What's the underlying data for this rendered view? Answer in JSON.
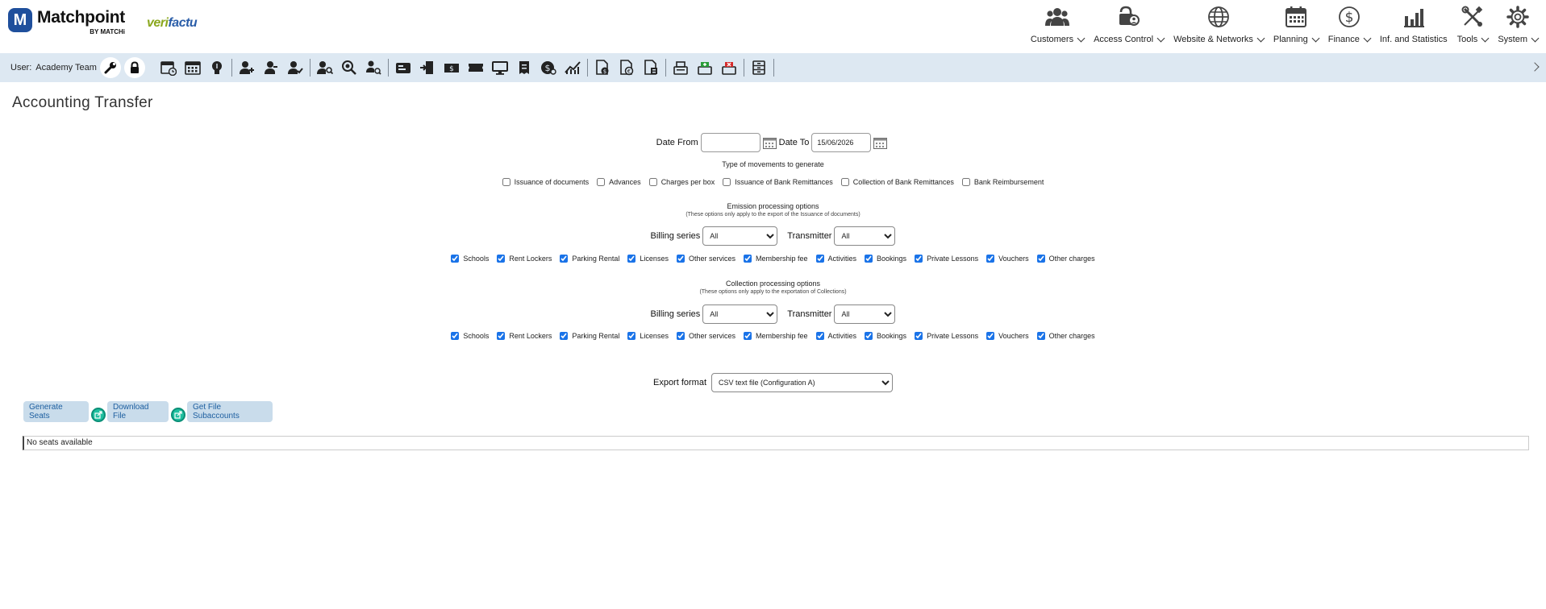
{
  "header": {
    "logo_text": "Matchpoint",
    "logo_letter": "M",
    "logo_sub": "BY MATCHi",
    "partner_logo_a": "veri",
    "partner_logo_b": "factu",
    "nav": [
      {
        "label": "Customers",
        "icon": "customers-icon",
        "dropdown": true
      },
      {
        "label": "Access Control",
        "icon": "access-control-icon",
        "dropdown": true
      },
      {
        "label": "Website & Networks",
        "icon": "globe-icon",
        "dropdown": true
      },
      {
        "label": "Planning",
        "icon": "calendar-icon",
        "dropdown": true
      },
      {
        "label": "Finance",
        "icon": "dollar-icon",
        "dropdown": true
      },
      {
        "label": "Inf. and Statistics",
        "icon": "bar-chart-icon",
        "dropdown": false
      },
      {
        "label": "Tools",
        "icon": "tools-icon",
        "dropdown": true
      },
      {
        "label": "System",
        "icon": "gear-icon",
        "dropdown": true
      }
    ]
  },
  "toolbar": {
    "user_label": "User:",
    "user_name": "Academy Team"
  },
  "page": {
    "title": "Accounting Transfer"
  },
  "dates": {
    "from_label": "Date From",
    "from_value": "",
    "to_label": "Date To",
    "to_value": "15/06/2026"
  },
  "movements": {
    "heading": "Type of movements to generate",
    "options": [
      {
        "label": "Issuance of documents",
        "checked": false
      },
      {
        "label": "Advances",
        "checked": false
      },
      {
        "label": "Charges per box",
        "checked": false
      },
      {
        "label": "Issuance of Bank Remittances",
        "checked": false
      },
      {
        "label": "Collection of Bank Remittances",
        "checked": false
      },
      {
        "label": "Bank Reimbursement",
        "checked": false
      }
    ]
  },
  "emission": {
    "heading": "Emission processing options",
    "note": "(These options only apply to the export of the Issuance of documents)",
    "billing_label": "Billing series",
    "billing_value": "All",
    "transmitter_label": "Transmitter",
    "transmitter_value": "All",
    "options": [
      {
        "label": "Schools",
        "checked": true
      },
      {
        "label": "Rent Lockers",
        "checked": true
      },
      {
        "label": "Parking Rental",
        "checked": true
      },
      {
        "label": "Licenses",
        "checked": true
      },
      {
        "label": "Other services",
        "checked": true
      },
      {
        "label": "Membership fee",
        "checked": true
      },
      {
        "label": "Activities",
        "checked": true
      },
      {
        "label": "Bookings",
        "checked": true
      },
      {
        "label": "Private Lessons",
        "checked": true
      },
      {
        "label": "Vouchers",
        "checked": true
      },
      {
        "label": "Other charges",
        "checked": true
      }
    ]
  },
  "collection": {
    "heading": "Collection processing options",
    "note": "(These options only apply to the exportation of Collections)",
    "billing_label": "Billing series",
    "billing_value": "All",
    "transmitter_label": "Transmitter",
    "transmitter_value": "All",
    "options": [
      {
        "label": "Schools",
        "checked": true
      },
      {
        "label": "Rent Lockers",
        "checked": true
      },
      {
        "label": "Parking Rental",
        "checked": true
      },
      {
        "label": "Licenses",
        "checked": true
      },
      {
        "label": "Other services",
        "checked": true
      },
      {
        "label": "Membership fee",
        "checked": true
      },
      {
        "label": "Activities",
        "checked": true
      },
      {
        "label": "Bookings",
        "checked": true
      },
      {
        "label": "Private Lessons",
        "checked": true
      },
      {
        "label": "Vouchers",
        "checked": true
      },
      {
        "label": "Other charges",
        "checked": true
      }
    ]
  },
  "export": {
    "label": "Export format",
    "value": "CSV text file (Configuration A)"
  },
  "actions": {
    "generate_label": "Generate Seats",
    "download_label": "Download File",
    "subaccounts_label": "Get File Subaccounts"
  },
  "results": {
    "empty_text": "No seats available"
  },
  "colors": {
    "toolbar_bg": "#dde8f2",
    "button_bg": "#c9dceb",
    "button_text": "#1e5fa0",
    "logo_blue": "#1f4f9c",
    "accent_green": "#1fbf9f"
  }
}
